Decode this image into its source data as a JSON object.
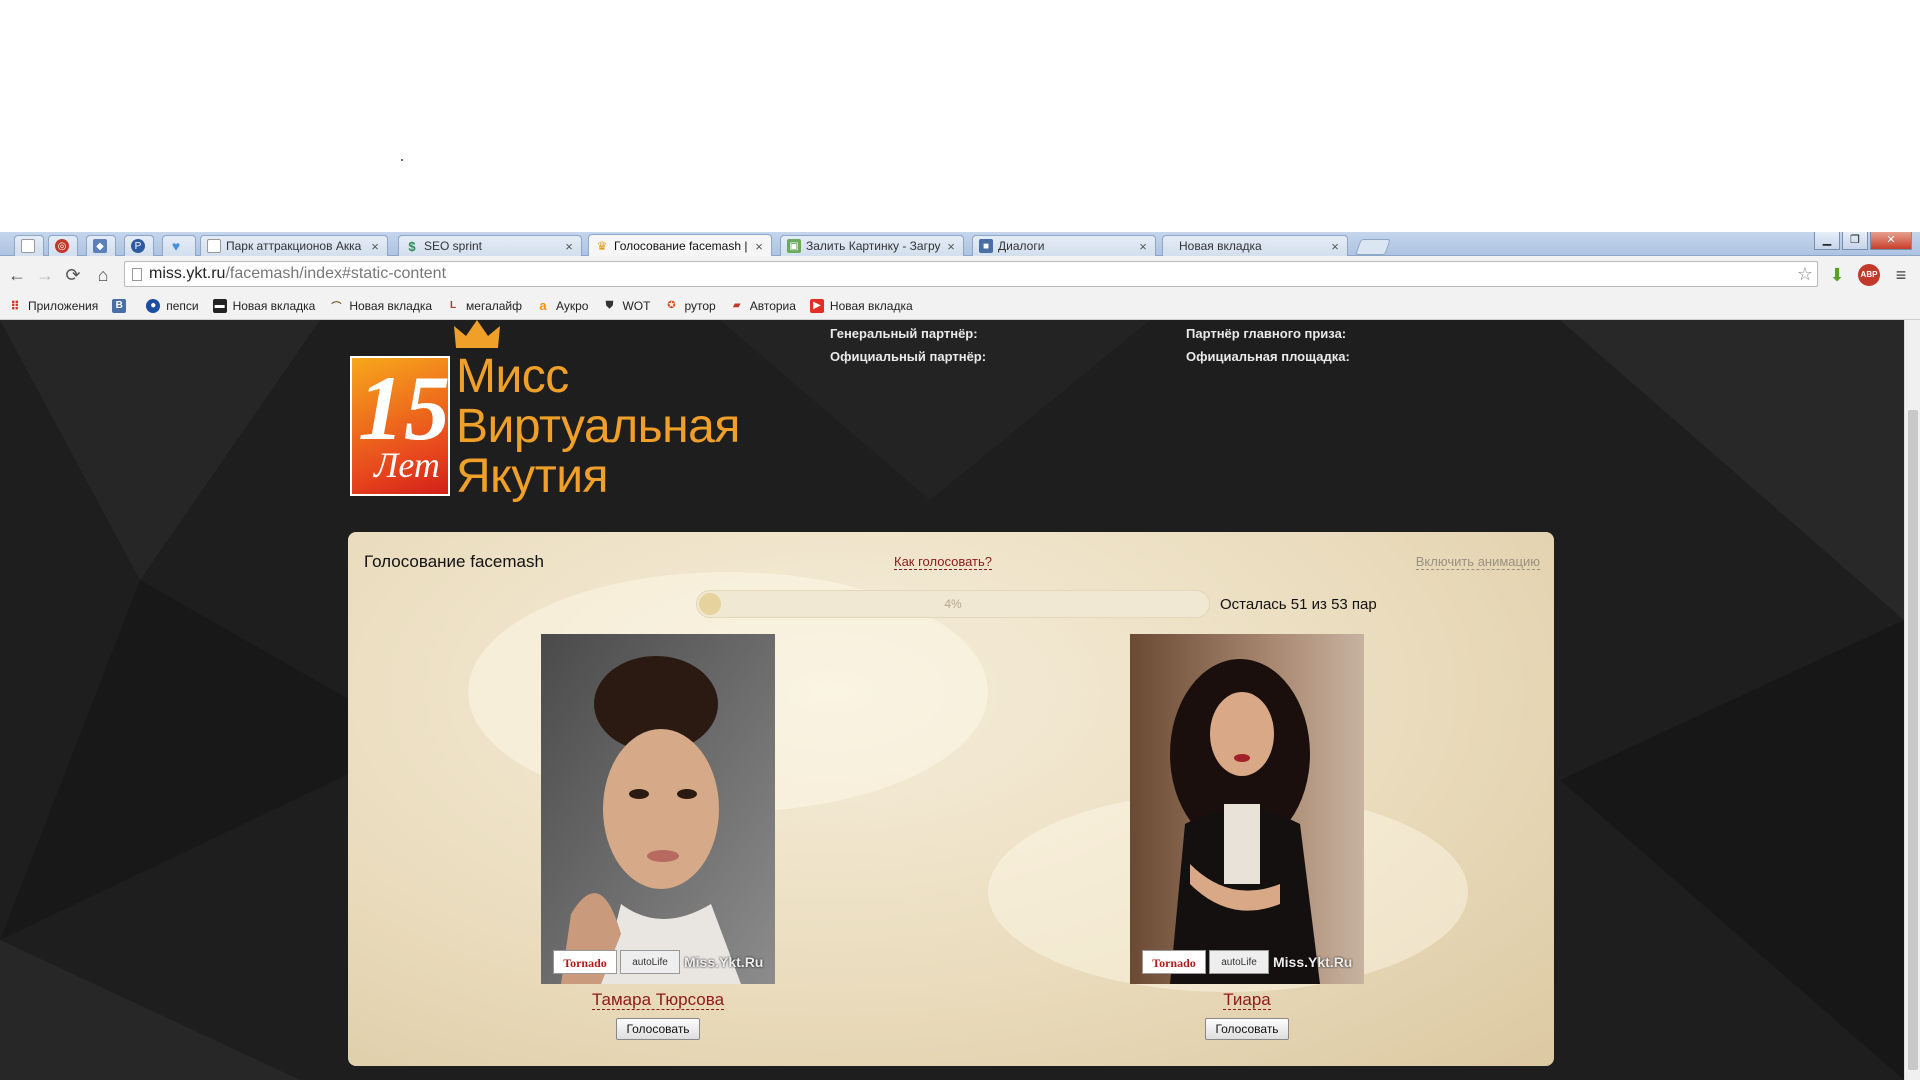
{
  "tabs": [
    {
      "title": "",
      "icon": "blank-page-icon"
    },
    {
      "title": "",
      "icon": "opera-icon"
    },
    {
      "title": "",
      "icon": "shield-icon"
    },
    {
      "title": "",
      "icon": "p-icon"
    },
    {
      "title": "",
      "icon": "heart-icon"
    },
    {
      "title": "Парк аттракционов Акка",
      "icon": "page-icon"
    },
    {
      "title": "SEO sprint",
      "icon": "seo-icon"
    },
    {
      "title": "Голосование facemash | Ш",
      "icon": "crown-icon"
    },
    {
      "title": "Залить Картинку - Загру",
      "icon": "image-icon"
    },
    {
      "title": "Диалоги",
      "icon": "vk-icon"
    },
    {
      "title": "Новая вкладка",
      "icon": ""
    }
  ],
  "address": {
    "domain": "miss.ykt.ru",
    "path": "/facemash/index#static-content"
  },
  "bookmarks": [
    {
      "label": "Приложения",
      "icon": "apps-icon",
      "color": "#d93025"
    },
    {
      "label": "",
      "icon": "vk-b-icon",
      "color": "#4a6fa5"
    },
    {
      "label": "пепси",
      "icon": "pepsi-icon",
      "color": "#1b4da1"
    },
    {
      "label": "Новая вкладка",
      "icon": "clapper-icon",
      "color": "#222222"
    },
    {
      "label": "Новая вкладка",
      "icon": "hammock-icon",
      "color": "#7a5a2a"
    },
    {
      "label": "мегалайф",
      "icon": "megalife-icon",
      "color": "#c03030"
    },
    {
      "label": "Аукро",
      "icon": "aukro-icon",
      "color": "#f39200"
    },
    {
      "label": "WOT",
      "icon": "wot-icon",
      "color": "#333333"
    },
    {
      "label": "рутор",
      "icon": "rutor-icon",
      "color": "#d9501e"
    },
    {
      "label": "Авториа",
      "icon": "car-icon",
      "color": "#c0392b"
    },
    {
      "label": "Новая вкладка",
      "icon": "youtube-icon",
      "color": "#e52d27"
    }
  ],
  "logo": {
    "number": "15",
    "years": "Лет",
    "line1": "Мисс",
    "line2": "Виртуальная",
    "line3": "Якутия"
  },
  "partners": {
    "general": "Генеральный партнёр:",
    "official": "Официальный партнёр:",
    "main_prize": "Партнёр главного приза:",
    "platform": "Официальная площадка:"
  },
  "voting": {
    "title": "Голосование facemash",
    "how_link": "Как голосовать?",
    "animation_link": "Включить анимацию",
    "progress_label": "4%",
    "progress_fraction": 0.04,
    "remaining": "Осталась 51 из 53 пар",
    "vote_label": "Голосовать",
    "watermark": {
      "brand": "Tornado",
      "partner": "autoLife",
      "site": "Miss.Ykt.Ru"
    },
    "contestants": [
      {
        "name": "Тамара Тюрсова"
      },
      {
        "name": "Тиара"
      }
    ]
  },
  "colors": {
    "accent_gold": "#f0a028",
    "link_red": "#8b1a1a",
    "page_bg": "#1e1e1e"
  }
}
